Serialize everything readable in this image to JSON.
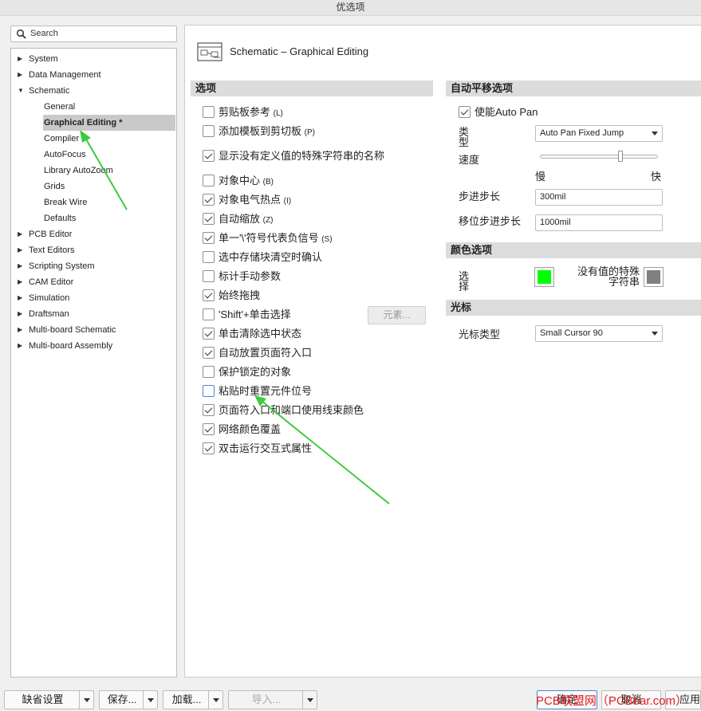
{
  "window": {
    "title": "优选项"
  },
  "search": {
    "placeholder": "Search"
  },
  "tree": {
    "items": [
      {
        "label": "System",
        "expandable": true
      },
      {
        "label": "Data Management",
        "expandable": true
      },
      {
        "label": "Schematic",
        "expanded": true
      },
      {
        "label": "General"
      },
      {
        "label": "Graphical Editing *",
        "selected": true
      },
      {
        "label": "Compiler"
      },
      {
        "label": "AutoFocus"
      },
      {
        "label": "Library AutoZoom"
      },
      {
        "label": "Grids"
      },
      {
        "label": "Break Wire"
      },
      {
        "label": "Defaults"
      },
      {
        "label": "PCB Editor",
        "expandable": true
      },
      {
        "label": "Text Editors",
        "expandable": true
      },
      {
        "label": "Scripting System",
        "expandable": true
      },
      {
        "label": "CAM Editor",
        "expandable": true
      },
      {
        "label": "Simulation",
        "expandable": true
      },
      {
        "label": "Draftsman",
        "expandable": true
      },
      {
        "label": "Multi-board Schematic",
        "expandable": true
      },
      {
        "label": "Multi-board Assembly",
        "expandable": true
      }
    ]
  },
  "page": {
    "title": "Schematic – Graphical Editing",
    "icon": "schematic-page-icon"
  },
  "options": {
    "section_title": "选项",
    "items": [
      {
        "label": "剪贴板参考",
        "hotkey": "(L)",
        "checked": false
      },
      {
        "label": "添加模板到剪切板",
        "hotkey": "(P)",
        "checked": false
      },
      {
        "label": "显示没有定义值的特殊字符串的名称",
        "hotkey": "",
        "checked": true
      },
      {
        "label": "对象中心",
        "hotkey": "(B)",
        "checked": false
      },
      {
        "label": "对象电气热点",
        "hotkey": "(I)",
        "checked": true
      },
      {
        "label": "自动缩放",
        "hotkey": "(Z)",
        "checked": true
      },
      {
        "label": "单一'\\'符号代表负信号",
        "hotkey": "(S)",
        "checked": true
      },
      {
        "label": "选中存储块清空时确认",
        "hotkey": "",
        "checked": false
      },
      {
        "label": "标计手动参数",
        "hotkey": "",
        "checked": false
      },
      {
        "label": "始终拖拽",
        "hotkey": "",
        "checked": true
      },
      {
        "label": "'Shift'+单击选择",
        "hotkey": "",
        "checked": false
      },
      {
        "label": "单击清除选中状态",
        "hotkey": "",
        "checked": true
      },
      {
        "label": "自动放置页面符入口",
        "hotkey": "",
        "checked": true
      },
      {
        "label": "保护锁定的对象",
        "hotkey": "",
        "checked": false
      },
      {
        "label": "粘贴时重置元件位号",
        "hotkey": "",
        "checked": false
      },
      {
        "label": "页面符入口和端口使用线束颜色",
        "hotkey": "",
        "checked": true
      },
      {
        "label": "网络颜色覆盖",
        "hotkey": "",
        "checked": true
      },
      {
        "label": "双击运行交互式属性",
        "hotkey": "",
        "checked": true
      }
    ],
    "elements_button": "元素..."
  },
  "autopan": {
    "section_title": "自动平移选项",
    "enable_label": "使能Auto Pan",
    "enabled": true,
    "type_label": "类型",
    "type_value": "Auto Pan Fixed Jump",
    "speed_label": "速度",
    "speed_level": 0.68,
    "slow_label": "慢",
    "fast_label": "快",
    "step_label": "步进步长",
    "step_value": "300mil",
    "shift_step_label": "移位步进步长",
    "shift_step_value": "1000mil"
  },
  "colors": {
    "section_title": "颜色选项",
    "selection_label": "选择",
    "selection_color": "#00ff00",
    "no_value_label": "没有值的特殊字符串",
    "no_value_color": "#808080"
  },
  "cursor": {
    "section_title": "光标",
    "type_label": "光标类型",
    "type_value": "Small Cursor 90"
  },
  "footer": {
    "defaults_button": "缺省设置",
    "save_button": "保存...",
    "load_button": "加载...",
    "import_button": "导入...",
    "ok_button": "确定",
    "cancel_button": "取消",
    "apply_button": "应用"
  },
  "watermark": "PCB联盟网（PCBbar.com）",
  "annotation_color": "#3dcc3d"
}
